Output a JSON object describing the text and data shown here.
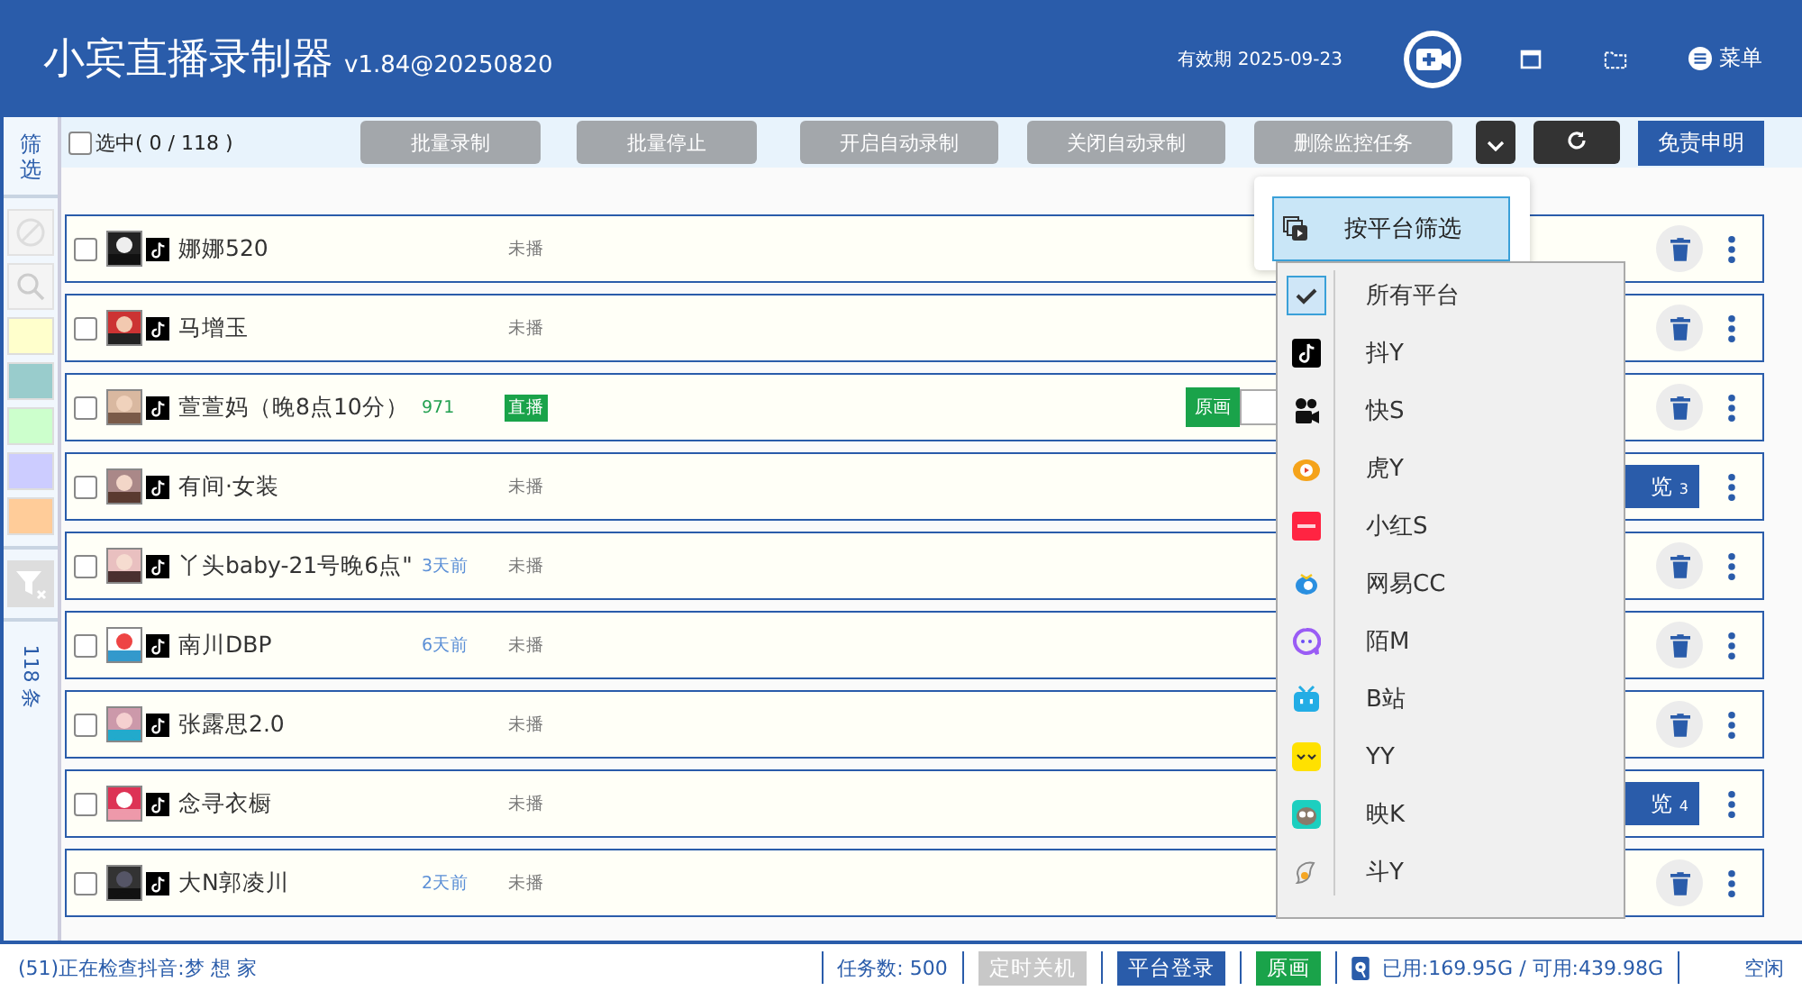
{
  "header": {
    "title": "小宾直播录制器",
    "version": "v1.84@20250820",
    "expiry": "有效期 2025-09-23",
    "menu": "菜单"
  },
  "sidebar": {
    "filter_label": "筛选",
    "swatches": [
      {
        "color": "#ffffcc"
      },
      {
        "color": "#99cccc"
      },
      {
        "color": "#ccffcc"
      },
      {
        "color": "#ccccff"
      },
      {
        "color": "#ffcc99"
      }
    ],
    "count": "118 条"
  },
  "toolbar": {
    "select_all": {
      "label": "选中( 0  /  118 )",
      "checked": false
    },
    "buttons": [
      "批量录制",
      "批量停止",
      "开启自动录制",
      "关闭自动录制",
      "删除监控任务"
    ],
    "disclaimer": "免责申明"
  },
  "rows": [
    {
      "name": "娜娜520",
      "status": "未播",
      "live": false,
      "checked": false
    },
    {
      "name": "马增玉",
      "status": "未播",
      "live": false,
      "checked": false
    },
    {
      "name": "萱萱妈（晚8点10分）",
      "viewers": "971",
      "status": "直播",
      "live": true,
      "checked": false,
      "quality": "原画"
    },
    {
      "name": "有间·女装",
      "status": "未播",
      "live": false,
      "checked": false,
      "browse": "览",
      "browse_count": "3"
    },
    {
      "name": "丫头baby-21号晚6点\"",
      "ago": "3天前",
      "status": "未播",
      "live": false,
      "checked": false
    },
    {
      "name": "南川DBP",
      "ago": "6天前",
      "status": "未播",
      "live": false,
      "checked": false
    },
    {
      "name": "张露思2.0",
      "status": "未播",
      "live": false,
      "checked": false
    },
    {
      "name": "念寻衣橱",
      "status": "未播",
      "live": false,
      "checked": false,
      "browse": "览",
      "browse_count": "4"
    },
    {
      "name": "大N郭凌川",
      "ago": "2天前",
      "status": "未播",
      "live": false,
      "checked": false
    }
  ],
  "filter_menu": {
    "title": "按平台筛选",
    "items": [
      {
        "label": "所有平台",
        "selected": true
      },
      {
        "label": "抖Y",
        "selected": false
      },
      {
        "label": "快S",
        "selected": false
      },
      {
        "label": "虎Y",
        "selected": false
      },
      {
        "label": "小红S",
        "selected": false
      },
      {
        "label": "网易CC",
        "selected": false
      },
      {
        "label": "陌M",
        "selected": false
      },
      {
        "label": "B站",
        "selected": false
      },
      {
        "label": "YY",
        "selected": false
      },
      {
        "label": "映K",
        "selected": false
      },
      {
        "label": "斗Y",
        "selected": false
      }
    ]
  },
  "status_bar": {
    "message": "(51)正在检查抖音:梦 想 家",
    "tasks": "任务数: 500",
    "shutdown": "定时关机",
    "login": "平台登录",
    "quality": "原画",
    "disk": "已用:169.95G / 可用:439.98G",
    "state": "空闲"
  }
}
